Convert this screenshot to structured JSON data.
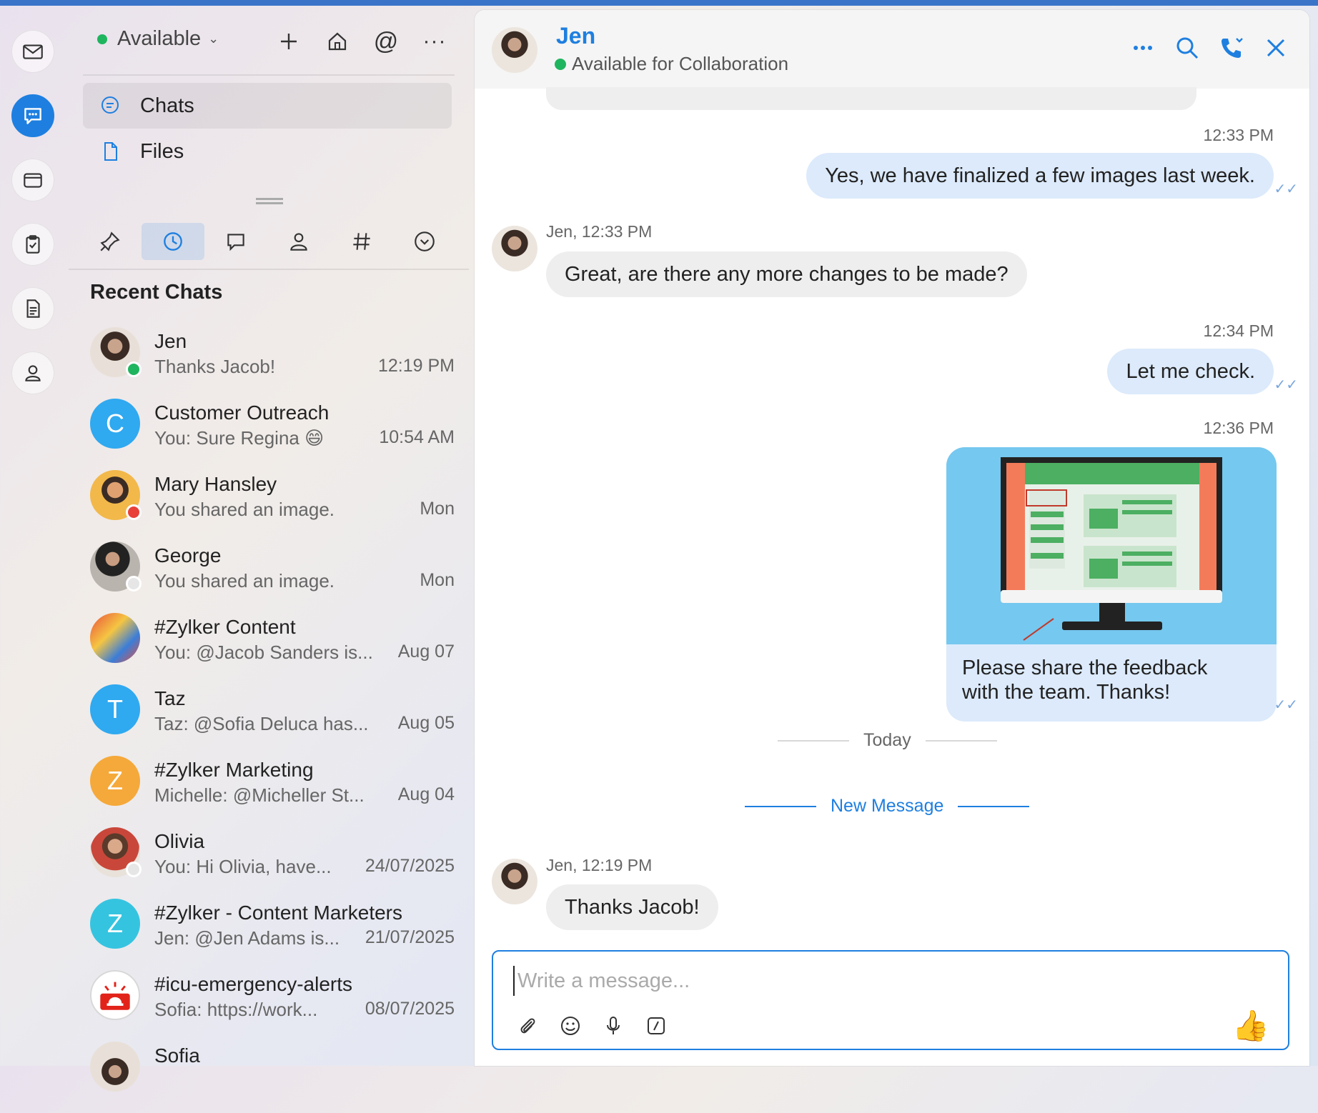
{
  "colors": {
    "accent": "#1e7fe0",
    "online": "#1fb55e",
    "busy": "#e8413a",
    "outgoing_bubble": "#dceafb",
    "incoming_bubble": "#eeeeee"
  },
  "rail": {
    "icons": [
      "mail-icon",
      "chat-icon",
      "wallet-icon",
      "clipboard-icon",
      "document-icon",
      "contact-icon"
    ],
    "active": "chat-icon"
  },
  "sidebar": {
    "status": "Available",
    "nav": [
      {
        "label": "Chats",
        "icon": "chat-bubble-icon",
        "active": true
      },
      {
        "label": "Files",
        "icon": "file-icon",
        "active": false
      }
    ],
    "filters": [
      "pin-icon",
      "clock-icon",
      "threads-icon",
      "person-icon",
      "hash-icon",
      "more-circle-icon"
    ],
    "active_filter": "clock-icon",
    "section_title": "Recent Chats",
    "chats": [
      {
        "name": "Jen",
        "preview": "Thanks Jacob!",
        "time": "12:19 PM",
        "avatar": "photo",
        "presence": "#1fb55e"
      },
      {
        "name": "Customer Outreach",
        "preview": "You: Sure Regina 😄",
        "time": "10:54 AM",
        "avatar_letter": "C",
        "avatar_color": "#2fa9f0"
      },
      {
        "name": "Mary Hansley",
        "preview": "You shared an image.",
        "time": "Mon",
        "avatar": "photo",
        "presence": "#e8413a"
      },
      {
        "name": "George",
        "preview": "You shared an image.",
        "time": "Mon",
        "avatar": "photo",
        "presence": "#e6e6e6"
      },
      {
        "name": "#Zylker Content",
        "preview": "You: @Jacob Sanders is...",
        "time": "Aug 07",
        "avatar": "photo"
      },
      {
        "name": "Taz",
        "preview": "Taz: @Sofia Deluca has...",
        "time": "Aug 05",
        "avatar_letter": "T",
        "avatar_color": "#2fa9f0"
      },
      {
        "name": "#Zylker Marketing",
        "preview": "Michelle: @Micheller St...",
        "time": "Aug 04",
        "avatar_letter": "Z",
        "avatar_color": "#f5a93a"
      },
      {
        "name": "Olivia",
        "preview": "You: Hi Olivia, have...",
        "time": "24/07/2025",
        "avatar": "photo",
        "presence": "#e6e6e6"
      },
      {
        "name": "#Zylker - Content Marketers",
        "preview": "Jen: @Jen Adams is...",
        "time": "21/07/2025",
        "avatar_letter": "Z",
        "avatar_color": "#35c4e0"
      },
      {
        "name": "#icu-emergency-alerts",
        "preview": "Sofia: https://work...",
        "time": "08/07/2025",
        "avatar": "emergency"
      },
      {
        "name": "Sofia",
        "preview": "",
        "time": "",
        "avatar": "photo"
      }
    ]
  },
  "conversation": {
    "contact_name": "Jen",
    "contact_status": "Available for Collaboration",
    "messages": [
      {
        "time": "12:33 PM",
        "text": "Yes, we have finalized a few images last week."
      },
      {
        "sender": "Jen, 12:33 PM",
        "text": "Great, are there any more changes to be made?"
      },
      {
        "time": "12:34 PM",
        "text": "Let me check."
      },
      {
        "time": "12:36 PM",
        "caption_line1": "Please share the feedback",
        "caption_line2": "with the team. Thanks!"
      },
      {
        "sender": "Jen, 12:19 PM",
        "text": "Thanks Jacob!"
      }
    ],
    "today_label": "Today",
    "new_message_label": "New Message",
    "composer_placeholder": "Write a message..."
  }
}
